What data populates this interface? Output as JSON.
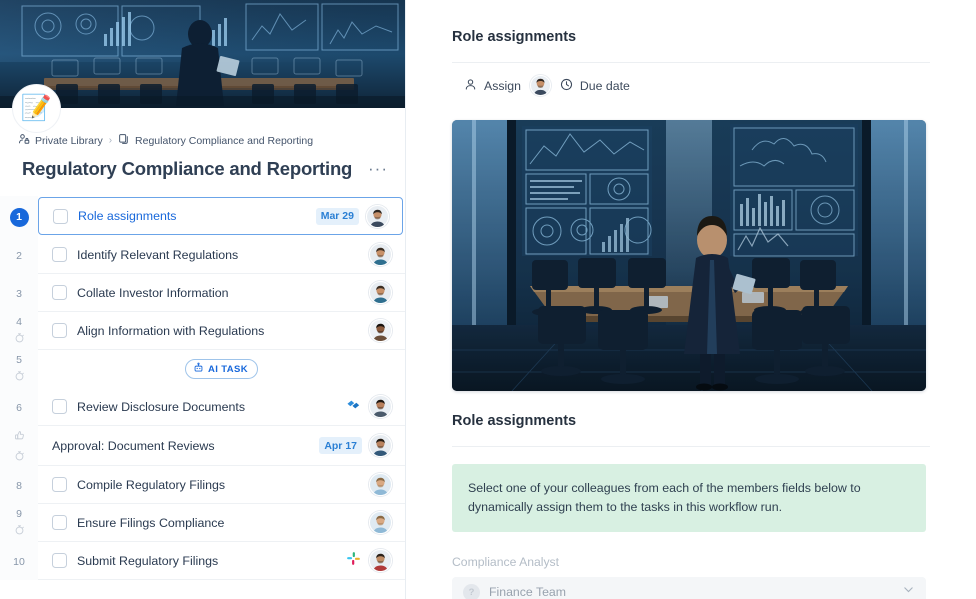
{
  "left": {
    "hero_alt": "modern-boardroom-with-data-dashboards",
    "doc_icon": "📝",
    "breadcrumb": {
      "library": "Private Library",
      "separator": "›",
      "current": "Regulatory Compliance and Reporting",
      "library_icon": "private-person-lock-icon",
      "current_icon": "duplicate-pages-icon"
    },
    "page_title": "Regulatory Compliance and Reporting",
    "more_label": "···",
    "ai_badge": {
      "label": "AI TASK",
      "icon": "robot-icon"
    },
    "tasks": [
      {
        "num": "1",
        "label": "Role assignments",
        "date": "Mar 29",
        "selected": true,
        "checkbox": true,
        "timer": false,
        "approval": false,
        "app": "",
        "avatar": "man-dark-hair"
      },
      {
        "num": "2",
        "label": "Identify Relevant Regulations",
        "date": "",
        "selected": false,
        "checkbox": true,
        "timer": false,
        "approval": false,
        "app": "",
        "avatar": "man-beard"
      },
      {
        "num": "3",
        "label": "Collate Investor Information",
        "date": "",
        "selected": false,
        "checkbox": true,
        "timer": false,
        "approval": false,
        "app": "",
        "avatar": "man-beard"
      },
      {
        "num": "4",
        "label": "Align Information with Regulations",
        "date": "",
        "selected": false,
        "checkbox": true,
        "timer": true,
        "approval": false,
        "app": "",
        "avatar": "woman-dark"
      },
      {
        "num": "5",
        "label": "",
        "date": "",
        "selected": false,
        "checkbox": false,
        "timer": true,
        "approval": false,
        "app": "",
        "avatar": ""
      },
      {
        "num": "6",
        "label": "Review Disclosure Documents",
        "date": "",
        "selected": false,
        "checkbox": true,
        "timer": false,
        "approval": false,
        "app": "dropbox",
        "avatar": "woman-glasses"
      },
      {
        "num": "",
        "label": "Approval: Document Reviews",
        "date": "Apr 17",
        "selected": false,
        "checkbox": false,
        "timer": true,
        "approval": true,
        "app": "",
        "avatar": "man-beard-dark"
      },
      {
        "num": "8",
        "label": "Compile Regulatory Filings",
        "date": "",
        "selected": false,
        "checkbox": true,
        "timer": false,
        "approval": false,
        "app": "",
        "avatar": "man-light"
      },
      {
        "num": "9",
        "label": "Ensure Filings Compliance",
        "date": "",
        "selected": false,
        "checkbox": true,
        "timer": true,
        "approval": false,
        "app": "",
        "avatar": "man-light"
      },
      {
        "num": "10",
        "label": "Submit Regulatory Filings",
        "date": "",
        "selected": false,
        "checkbox": true,
        "timer": false,
        "approval": false,
        "app": "slack",
        "avatar": "man-red"
      }
    ]
  },
  "right": {
    "title": "Role assignments",
    "assign_label": "Assign",
    "due_date_label": "Due date",
    "assign_icon": "person-icon",
    "clock_icon": "clock-icon",
    "hero_alt": "modern-boardroom-with-data-dashboards",
    "section_title": "Role assignments",
    "note": "Select one of your colleagues from each of the members fields below to dynamically assign them to the tasks in this workflow run.",
    "field_label": "Compliance Analyst",
    "field_value": "Finance Team",
    "field_avatar_glyph": "?",
    "chevron_icon": "chevron-down-icon"
  },
  "colors": {
    "accent": "#1868db",
    "note_bg": "#d8f0e2",
    "chip_bg": "#e4f0fb",
    "chip_text": "#2a7fd4"
  }
}
